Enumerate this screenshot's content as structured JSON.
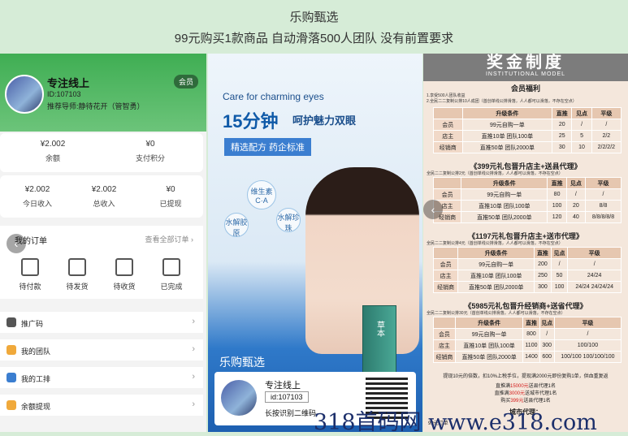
{
  "header": {
    "title": "乐购甄选",
    "subtitle": "99元购买1款商品 自动滑落500人团队 没有前置要求"
  },
  "profile": {
    "name": "专注线上",
    "id": "ID:107103",
    "referrer": "推荐导师:静待花开（管智勇）",
    "badge": "会员"
  },
  "balance": {
    "cells": [
      {
        "value": "¥2.002",
        "label": "余额"
      },
      {
        "value": "¥0",
        "label": "支付积分"
      }
    ]
  },
  "income": {
    "cells": [
      {
        "value": "¥2.002",
        "label": "今日收入"
      },
      {
        "value": "¥2.002",
        "label": "总收入"
      },
      {
        "value": "¥0",
        "label": "已提现"
      }
    ]
  },
  "orders": {
    "title": "我的订单",
    "more": "查看全部订单 ›",
    "items": [
      "待付款",
      "待发货",
      "待收货",
      "已完成"
    ]
  },
  "menu": [
    {
      "label": "推广码",
      "color": "#555555"
    },
    {
      "label": "我的团队",
      "color": "#f0a93b"
    },
    {
      "label": "我的工排",
      "color": "#3b7ed0"
    },
    {
      "label": "余额提现",
      "color": "#f0a93b"
    }
  ],
  "poster": {
    "english": "Care for charming eyes",
    "headline": "15分钟",
    "headline2": "呵护魅力双眼",
    "tag": "精选配方 药企标准",
    "bubbles": [
      "维生素C·A",
      "水解胶原",
      "水解珍珠"
    ],
    "product_label": "草本",
    "brand": "乐购甄选",
    "card_name": "专注线上",
    "card_id": "id:107103",
    "card_scan": "长按识别二维码"
  },
  "reward": {
    "title": "奖金制度",
    "title_en": "INSTITUTIONAL MODEL",
    "section_member": "会员福利",
    "notes_member": [
      "1.享受500人团队收益",
      "2.全民二二复制公排10人成团（首创单线公排滑落，人人都可以滑落，不存在空点）"
    ],
    "headers": [
      "",
      "升级条件",
      "直推",
      "见点",
      "平级"
    ],
    "table1": [
      [
        "会员",
        "99元自购一单",
        "20",
        "/",
        "/"
      ],
      [
        "店主",
        "直推10单 团队100单",
        "25",
        "5",
        "2/2"
      ],
      [
        "经销商",
        "直推50单 团队2000单",
        "30",
        "10",
        "2/2/2/2"
      ]
    ],
    "section2": "《399元礼包晋升店主+送县代理》",
    "note2": "全民二二复制公排2元（首创单线公排滑落，人人都可以滑落，不存在空点）",
    "table2": [
      [
        "会员",
        "99元自购一单",
        "80",
        "/",
        "/"
      ],
      [
        "店主",
        "直推10单 团队100单",
        "100",
        "20",
        "8/8"
      ],
      [
        "经销商",
        "直推50单 团队2000单",
        "120",
        "40",
        "8/8/8/8/8"
      ]
    ],
    "section3": "《1197元礼包晋升店主+送市代理》",
    "note3": "全民二二复制公排4元（首创单线公排滑落，人人都可以滑落，不存在空点）",
    "table3": [
      [
        "会员",
        "99元自购一单",
        "200",
        "/",
        "/"
      ],
      [
        "店主",
        "直推10单 团队100单",
        "250",
        "50",
        "24/24"
      ],
      [
        "经销商",
        "直推50单 团队2000单",
        "300",
        "100",
        "24/24 24/24/24"
      ]
    ],
    "section4": "《5985元礼包晋升经销商+送省代理》",
    "note4": "全民二二复制公排30元（首创单线公排滑落，人人都可以滑落，不存在空点）",
    "table4": [
      [
        "会员",
        "99元自购一单",
        "800",
        "/",
        "/"
      ],
      [
        "店主",
        "直推10单 团队100单",
        "1100",
        "300",
        "100/100"
      ],
      [
        "经销商",
        "直推50单 团队2000单",
        "1400",
        "600",
        "100/100 100/100/100"
      ]
    ],
    "foot1": "提现10元的倍数，扣10%上税手位，提现满2000元即份复购1单，供血重复返",
    "foot2_a": "直推满",
    "foot2_b": "15000元",
    "foot2_c": "送县代理1名",
    "foot3_a": "直推满",
    "foot3_b": "3000元",
    "foot3_c": "送城市代理1名",
    "foot4_a": "购买",
    "foot4_b": "399元",
    "foot4_c": "送县代理1名",
    "foot5": "城市代理：",
    "foot6": "99元订单"
  },
  "watermark": "318首码网 www.e318.com"
}
